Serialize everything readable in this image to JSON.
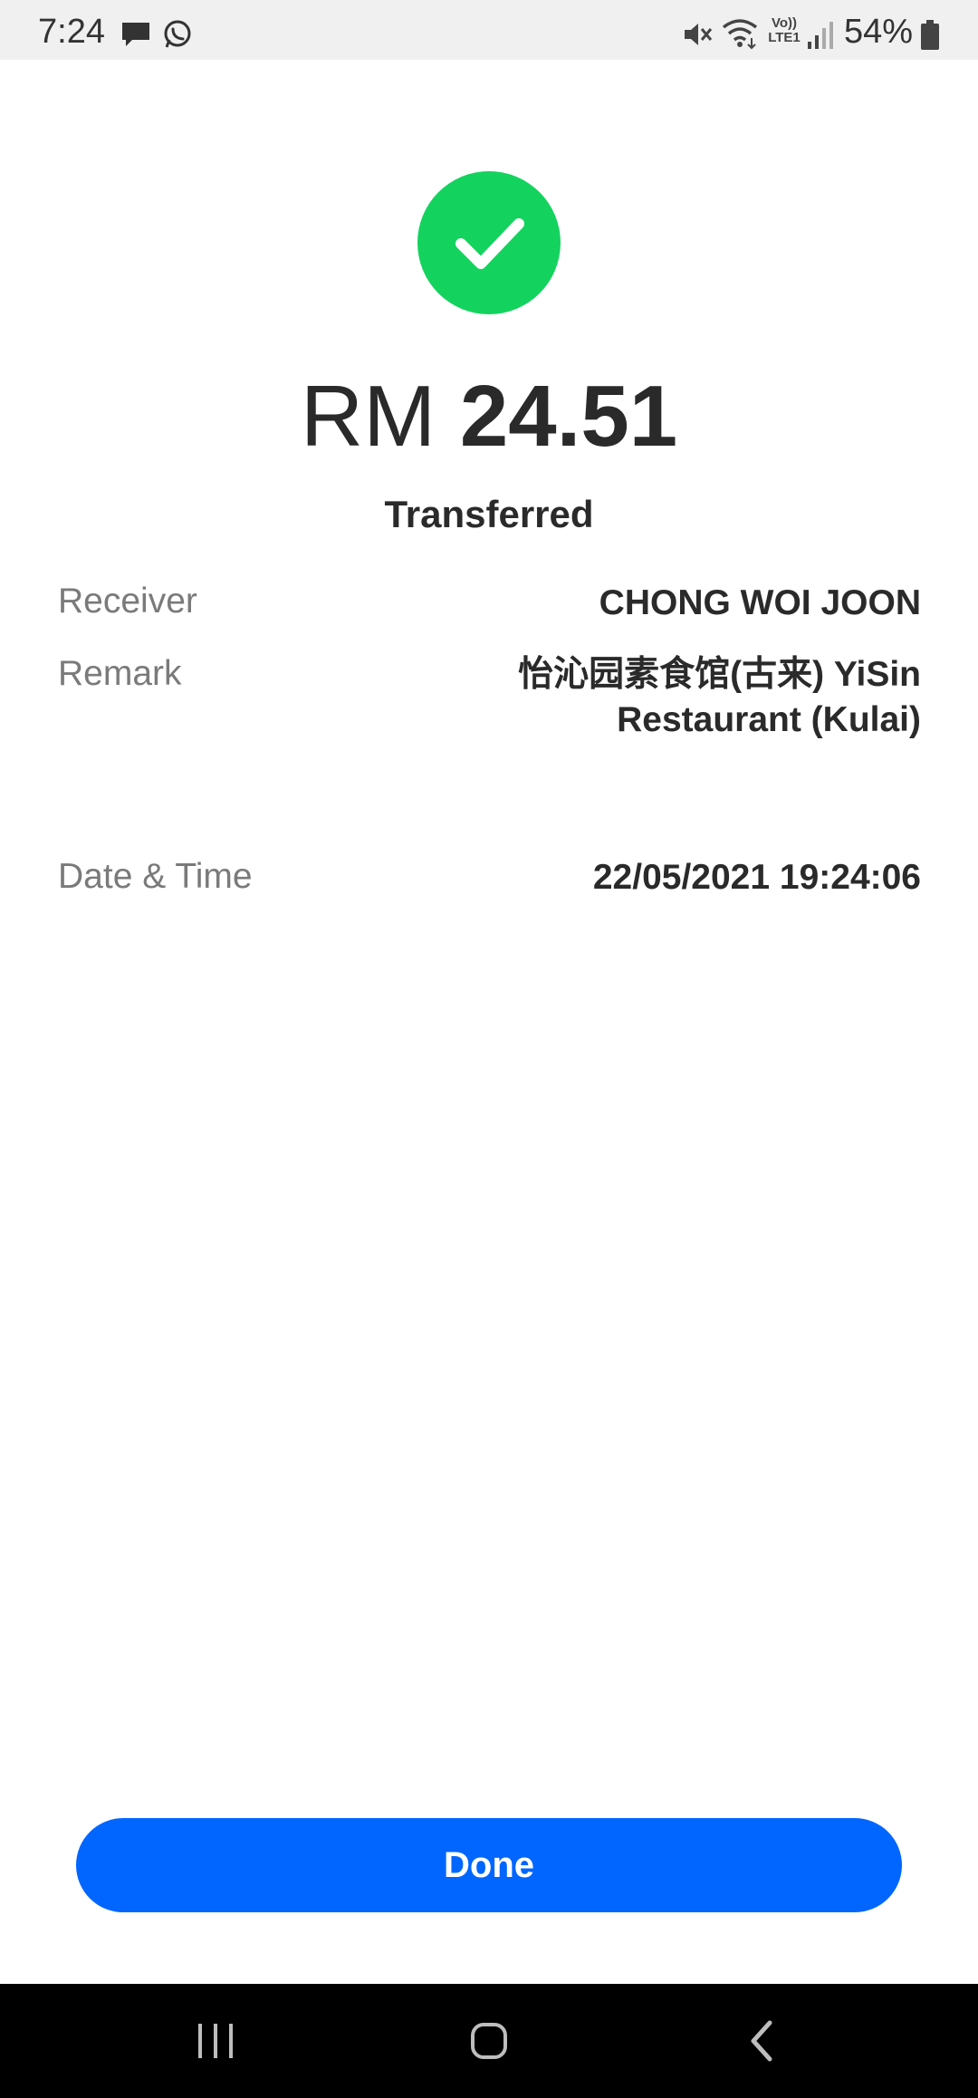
{
  "status_bar": {
    "time": "7:24",
    "battery": "54%",
    "network": "Vo)) LTE1",
    "icons": [
      "message-icon",
      "whatsapp-icon",
      "mute-icon",
      "wifi-icon",
      "volte-icon",
      "signal-icon",
      "battery-icon"
    ]
  },
  "receipt": {
    "currency": "RM",
    "amount": "24.51",
    "status": "Transferred",
    "receiver_label": "Receiver",
    "receiver_value": "CHONG WOI JOON",
    "remark_label": "Remark",
    "remark_value": "怡沁园素食馆(古来) YiSin Restaurant (Kulai)",
    "datetime_label": "Date & Time",
    "datetime_value": "22/05/2021 19:24:06"
  },
  "actions": {
    "done_label": "Done"
  },
  "colors": {
    "success": "#13d35e",
    "primary": "#0066ff",
    "text": "#2a2a2a",
    "muted": "#7a7a7a"
  }
}
